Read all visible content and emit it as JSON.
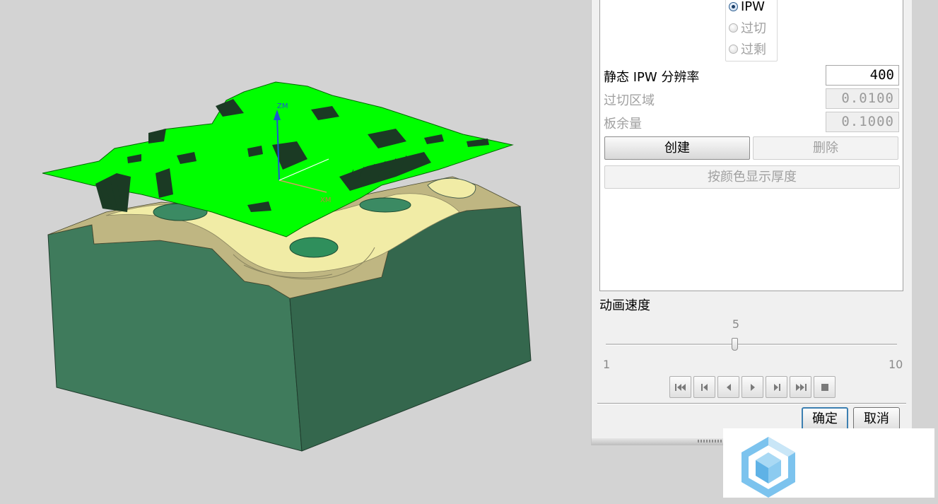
{
  "viewport": {
    "axis_labels": {
      "z": "ZM",
      "x": "XM",
      "y": "YM"
    },
    "colors": {
      "background": "#d3d3d3",
      "mesh": "#00ff00",
      "block_side": "#3f7b5c",
      "block_side_dark": "#34674d",
      "block_top": "#bfb682",
      "cavity": "#f1eca6"
    }
  },
  "dialog": {
    "radio_options": [
      {
        "label": "IPW",
        "selected": true,
        "enabled": true
      },
      {
        "label": "过切",
        "selected": false,
        "enabled": false
      },
      {
        "label": "过剩",
        "selected": false,
        "enabled": false
      }
    ],
    "resolution": {
      "label": "静态 IPW 分辨率",
      "value": "400"
    },
    "gouge_region": {
      "label": "过切区域",
      "value": "0.0100"
    },
    "plate_stock": {
      "label": "板余量",
      "value": "0.1000"
    },
    "create_button": "创建",
    "delete_button": "删除",
    "show_thickness_button": "按颜色显示厚度",
    "animation": {
      "title": "动画速度",
      "value": "5",
      "min": "1",
      "max": "10",
      "speed_fraction": 0.444,
      "controls": [
        "go-to-start-icon",
        "step-back-icon",
        "play-reverse-icon",
        "play-icon",
        "step-forward-icon",
        "go-to-end-icon",
        "stop-icon"
      ]
    },
    "ok_button": "确定",
    "cancel_button": "取消"
  },
  "watermark": {
    "icon": "cube-logo-icon",
    "colors": {
      "primary": "#7cc3ee",
      "secondary": "#c9e6f7"
    }
  }
}
